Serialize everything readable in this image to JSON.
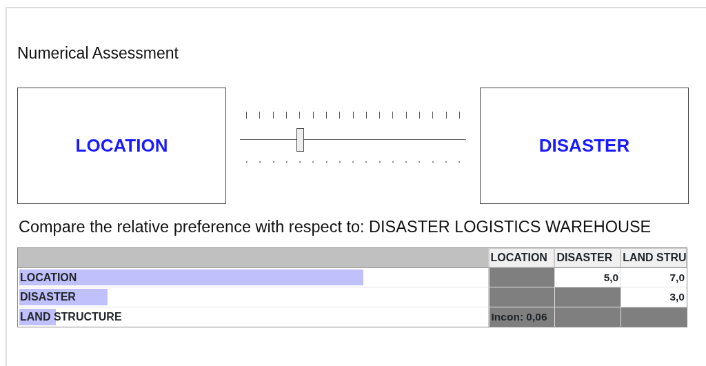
{
  "title": "Numerical Assessment",
  "comparison": {
    "left": "LOCATION",
    "right": "DISASTER",
    "slider": {
      "level": 0.25
    }
  },
  "prompt": "Compare the relative preference with respect to: DISASTER LOGISTICS WAREHOUSE",
  "table": {
    "columns": [
      "LOCATION",
      "DISASTER",
      "LAND STRU"
    ],
    "rows": [
      {
        "label": "LOCATION",
        "level": 0.73,
        "cells": [
          {
            "kind": "shaded"
          },
          {
            "kind": "value",
            "text": "5,0"
          },
          {
            "kind": "value",
            "text": "7,0"
          }
        ]
      },
      {
        "label": "DISASTER",
        "level": 0.187,
        "cells": [
          {
            "kind": "shaded"
          },
          {
            "kind": "shaded"
          },
          {
            "kind": "value",
            "text": "3,0"
          }
        ]
      },
      {
        "label": "LAND STRUCTURE",
        "level": 0.077,
        "cells": [
          {
            "kind": "shaded",
            "text": "Incon: 0,06"
          },
          {
            "kind": "shaded"
          },
          {
            "kind": "shaded"
          }
        ]
      }
    ]
  }
}
